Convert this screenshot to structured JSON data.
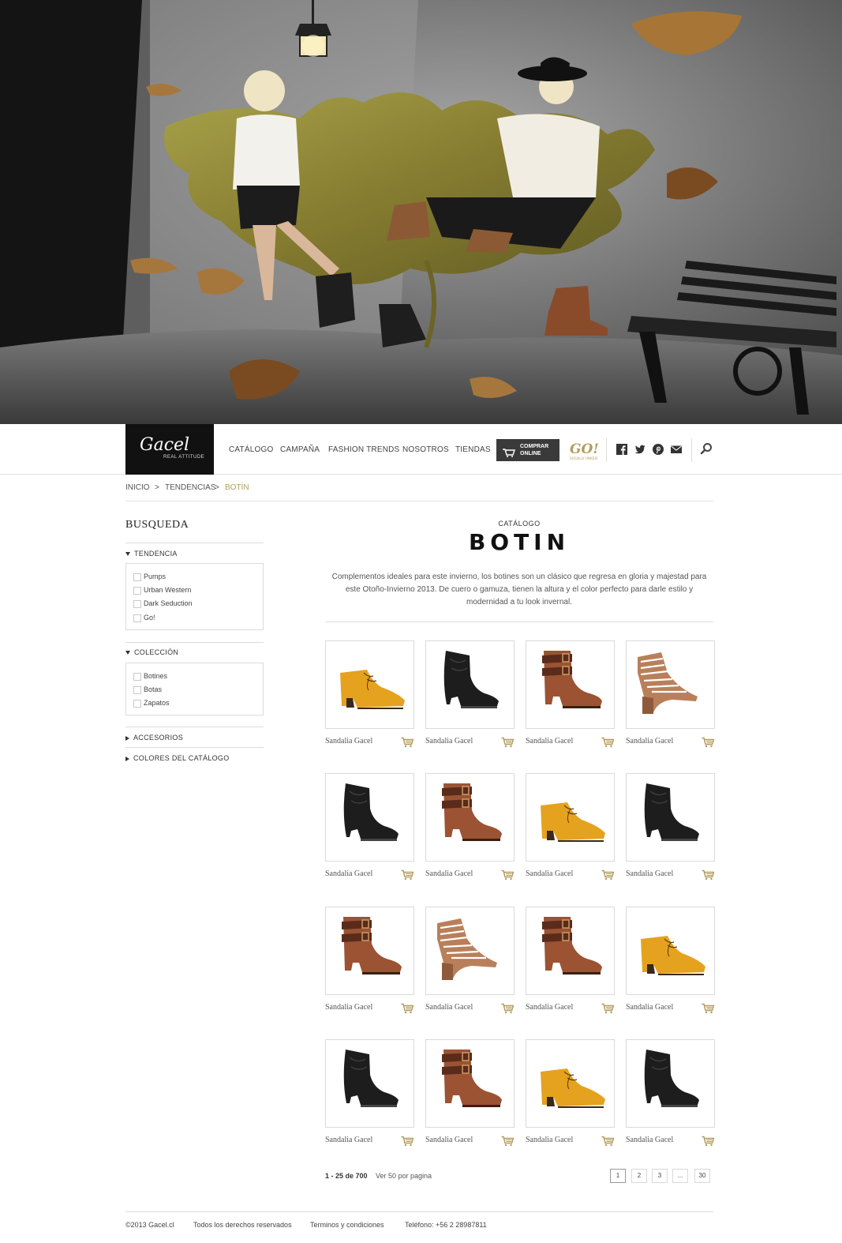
{
  "nav": {
    "logo_brand": "Gacel",
    "logo_tagline": "REAL ATTITUDE",
    "links": [
      "CATÁLOGO",
      "CAMPAÑA",
      "FASHION TRENDS",
      "NOSOTROS",
      "TIENDAS"
    ],
    "buy_line1": "COMPRAR",
    "buy_line2": "ONLINE",
    "go_logo": "GO!",
    "go_sub": "SOCIALLY UNIQUE",
    "social_icons": [
      "facebook-icon",
      "twitter-icon",
      "pinterest-icon",
      "mail-icon"
    ],
    "search_icon": "search-icon"
  },
  "breadcrumb": {
    "items": [
      "INICIO",
      "TENDENCIAS"
    ],
    "separator": ">",
    "current": "BOTÍN"
  },
  "sidebar": {
    "title": "BUSQUEDA",
    "facets": [
      {
        "label": "TENDENCIA",
        "expanded": true,
        "options": [
          "Pumps",
          "Urban Western",
          "Dark Seduction",
          "Go!"
        ]
      },
      {
        "label": "COLECCIÓN",
        "expanded": true,
        "options": [
          "Botines",
          "Botas",
          "Zapatos"
        ]
      },
      {
        "label": "ACCESORIOS",
        "expanded": false
      },
      {
        "label": "COLORES DEL CATÁLOGO",
        "expanded": false
      }
    ]
  },
  "main": {
    "section_label": "CATÁLOGO",
    "title": "BOTIN",
    "description": "Complementos ideales para este invierno, los botines son un clásico que regresa en gloria y majestad para este Otoño-Invierno 2013. De cuero o gamuza, tienen la altura y el color perfecto para darle estilo y modernidad a tu look invernal.",
    "products": [
      {
        "name": "Sandalia Gacel",
        "style": "yellow-lace"
      },
      {
        "name": "Sandalia Gacel",
        "style": "black-western"
      },
      {
        "name": "Sandalia Gacel",
        "style": "brown-strap"
      },
      {
        "name": "Sandalia Gacel",
        "style": "wedge-sandal"
      },
      {
        "name": "Sandalia Gacel",
        "style": "black-western"
      },
      {
        "name": "Sandalia Gacel",
        "style": "brown-strap"
      },
      {
        "name": "Sandalia Gacel",
        "style": "yellow-lace"
      },
      {
        "name": "Sandalia Gacel",
        "style": "black-western"
      },
      {
        "name": "Sandalia Gacel",
        "style": "brown-strap"
      },
      {
        "name": "Sandalia Gacel",
        "style": "wedge-sandal"
      },
      {
        "name": "Sandalia Gacel",
        "style": "brown-strap"
      },
      {
        "name": "Sandalia Gacel",
        "style": "yellow-lace"
      },
      {
        "name": "Sandalia Gacel",
        "style": "black-western"
      },
      {
        "name": "Sandalia Gacel",
        "style": "brown-strap"
      },
      {
        "name": "Sandalia Gacel",
        "style": "yellow-lace"
      },
      {
        "name": "Sandalia Gacel",
        "style": "black-western"
      }
    ],
    "results_count": "1 - 25 de 700",
    "per_page": "Ver 50 por pagina",
    "pages": [
      "1",
      "2",
      "3",
      "...",
      "30"
    ],
    "current_page": "1"
  },
  "footer": {
    "copyright": "©2013 Gacel.cl",
    "rights": "Todos los derechos reservados",
    "terms": "Terminos y condiciones",
    "phone": "Teléfono: +56 2 28987811"
  },
  "colors": {
    "accent_gold": "#b39b5f",
    "dark": "#111111",
    "button_dark": "#3a3a3a",
    "border": "#dcdcdc"
  }
}
